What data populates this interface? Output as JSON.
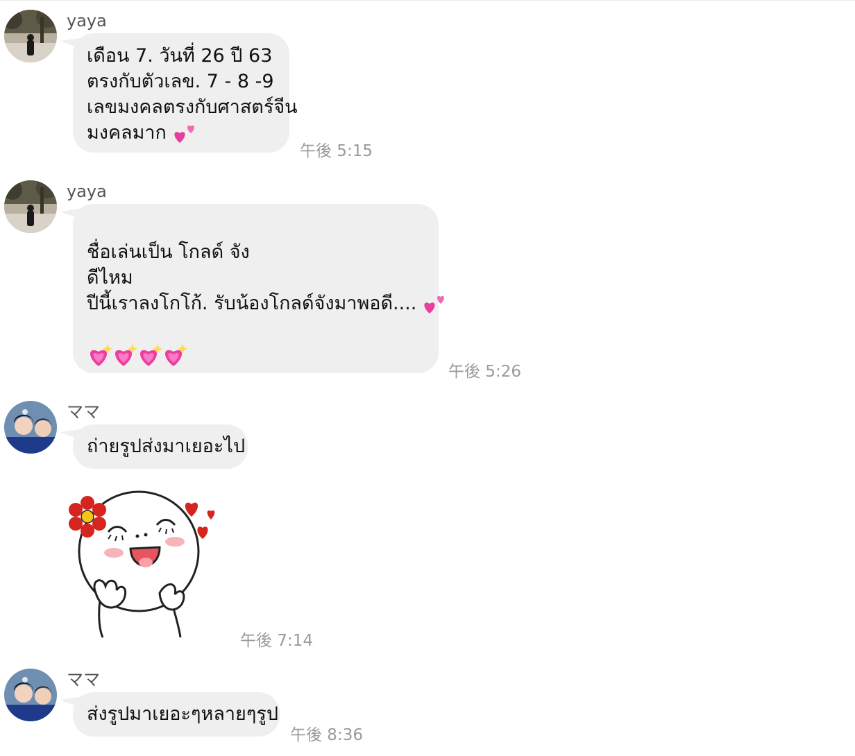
{
  "messages": [
    {
      "sender": "yaya",
      "lines": [
        "เดือน 7. วันที่ 26 ปี 63",
        "ตรงกับตัวเลข. 7 - 8 -9",
        "เลขมงคลตรงกับศาสตร์จีน",
        "มงคลมาก"
      ],
      "emoji": "two-hearts",
      "time": "午後 5:15"
    },
    {
      "sender": "yaya",
      "lines": [
        "",
        "ชื่อเล่นเป็น โกลด์ จัง",
        "ดีไหม",
        "ปีนี้เราลงโกโก้.  รับน้องโกลด์จังมาพอดี....",
        ""
      ],
      "emoji": "two-hearts",
      "trailing_emoji": "sparkling-heart x4",
      "time": "午後 5:26"
    },
    {
      "sender": "ママ",
      "lines": [
        "ถ่ายรูปส่งมาเยอะไป"
      ]
    },
    {
      "sticker": "smiling-face-with-flower-and-hearts",
      "time": "午後 7:14"
    },
    {
      "sender": "ママ",
      "lines": [
        "ส่งรูปมาเยอะๆหลายๆรูป"
      ],
      "time": "午後 8:36"
    }
  ],
  "colors": {
    "bubble": "#efefef",
    "timestamp": "#9a9a9a",
    "sender": "#555555",
    "heart_pink": "#e83e9c"
  }
}
